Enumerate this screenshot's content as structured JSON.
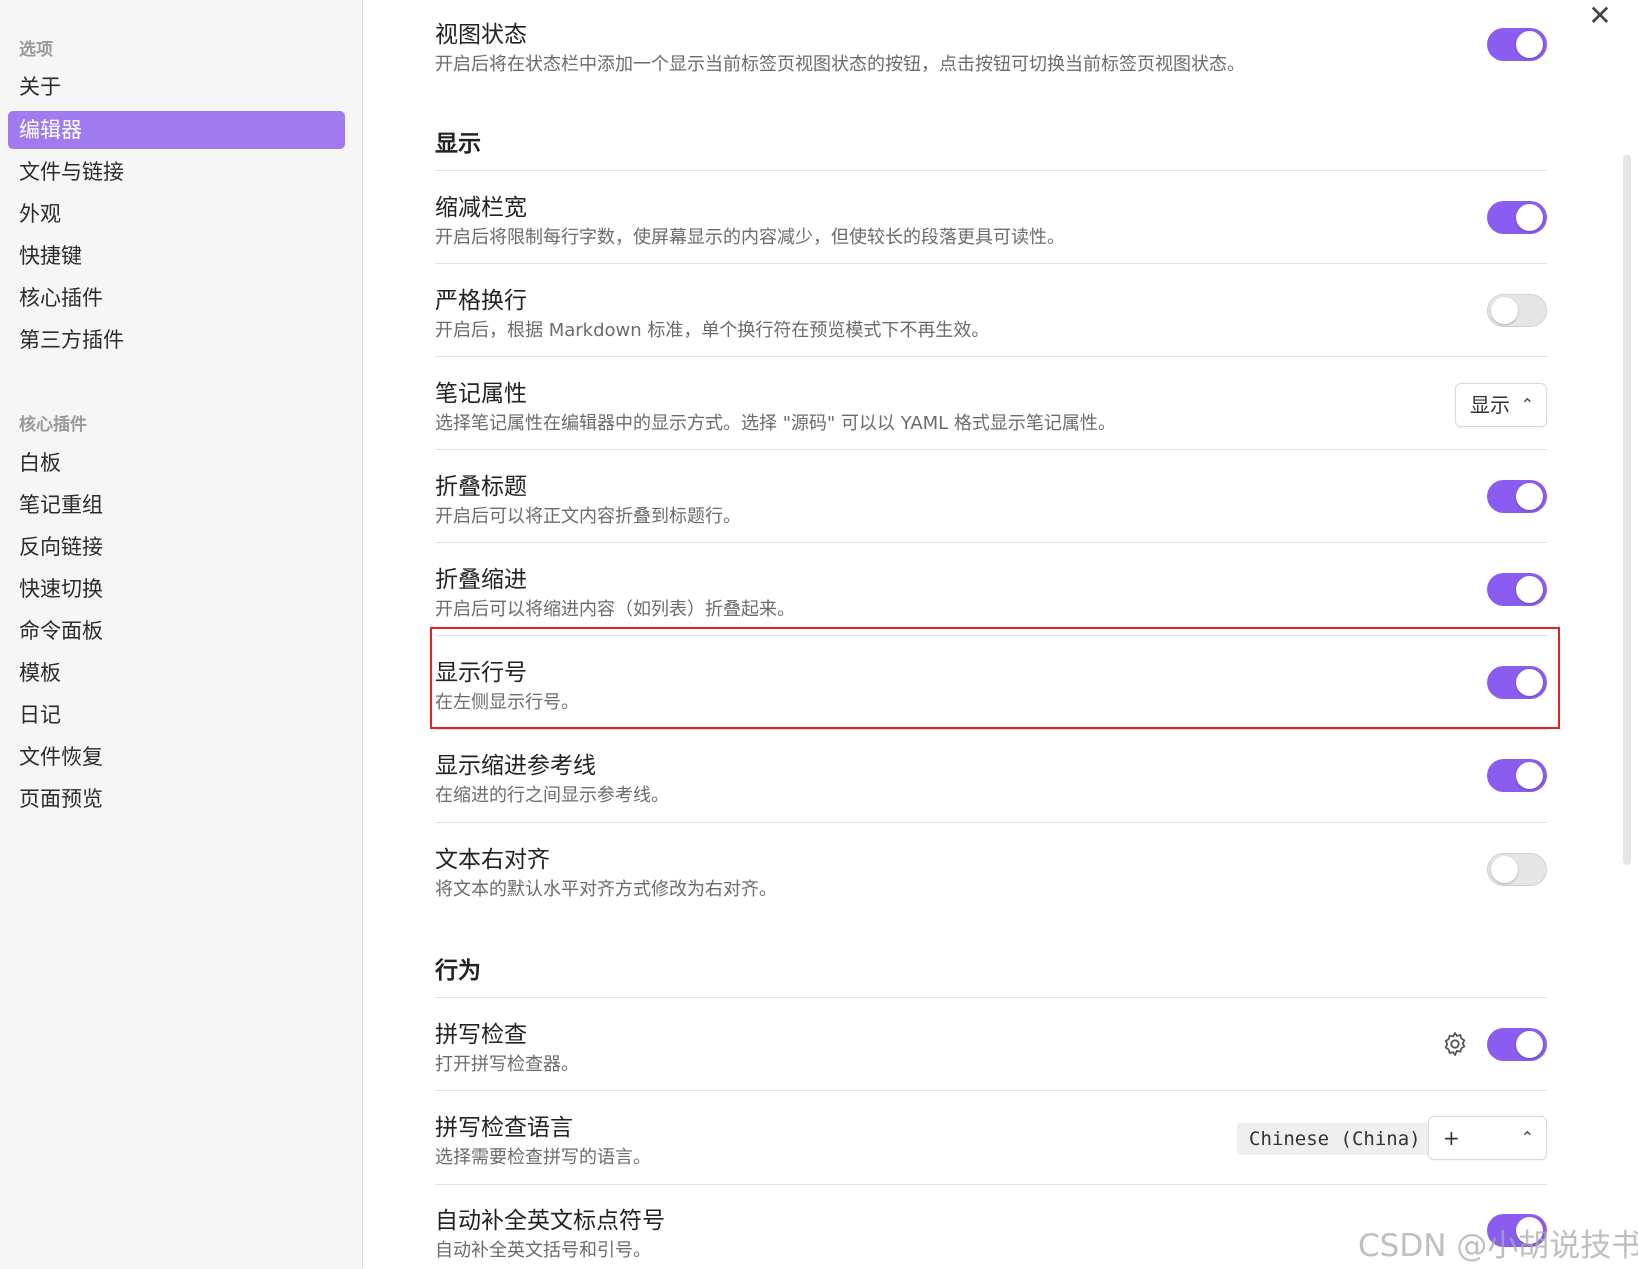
{
  "sidebar": {
    "options_heading": "选项",
    "options": [
      "关于",
      "编辑器",
      "文件与链接",
      "外观",
      "快捷键",
      "核心插件",
      "第三方插件"
    ],
    "core_heading": "核心插件",
    "core_plugins": [
      "白板",
      "笔记重组",
      "反向链接",
      "快速切换",
      "命令面板",
      "模板",
      "日记",
      "文件恢复",
      "页面预览"
    ]
  },
  "close_label": "✕",
  "rows": {
    "view_state": {
      "title": "视图状态",
      "desc": "开启后将在状态栏中添加一个显示当前标签页视图状态的按钮，点击按钮可切换当前标签页视图状态。",
      "enabled": true
    },
    "readable_width": {
      "title": "缩减栏宽",
      "desc": "开启后将限制每行字数，使屏幕显示的内容减少，但使较长的段落更具可读性。",
      "enabled": true
    },
    "strict_line_breaks": {
      "title": "严格换行",
      "desc": "开启后，根据 Markdown 标准，单个换行符在预览模式下不再生效。",
      "enabled": false
    },
    "properties": {
      "title": "笔记属性",
      "desc": "选择笔记属性在编辑器中的显示方式。选择 \"源码\" 可以以 YAML 格式显示笔记属性。",
      "value": "显示"
    },
    "fold_heading": {
      "title": "折叠标题",
      "desc": "开启后可以将正文内容折叠到标题行。",
      "enabled": true
    },
    "fold_indent": {
      "title": "折叠缩进",
      "desc": "开启后可以将缩进内容（如列表）折叠起来。",
      "enabled": true
    },
    "line_numbers": {
      "title": "显示行号",
      "desc": "在左侧显示行号。",
      "enabled": true
    },
    "indent_guides": {
      "title": "显示缩进参考线",
      "desc": "在缩进的行之间显示参考线。",
      "enabled": true
    },
    "rtl": {
      "title": "文本右对齐",
      "desc": "将文本的默认水平对齐方式修改为右对齐。",
      "enabled": false
    },
    "spellcheck": {
      "title": "拼写检查",
      "desc": "打开拼写检查器。",
      "enabled": true
    },
    "spellcheck_lang": {
      "title": "拼写检查语言",
      "desc": "选择需要检查拼写的语言。",
      "tag": "Chinese (China)",
      "add_label": "+"
    },
    "autopair": {
      "title": "自动补全英文标点符号",
      "desc": "自动补全英文括号和引号。",
      "enabled": true
    }
  },
  "sections": {
    "display": "显示",
    "behavior": "行为"
  },
  "watermark": "CSDN @小胡说技书",
  "colors": {
    "accent": "#8b5cf0",
    "highlight": "#e8211f"
  },
  "icons": {
    "select_chevron": "⌃⌄",
    "gear": "gear-icon"
  }
}
